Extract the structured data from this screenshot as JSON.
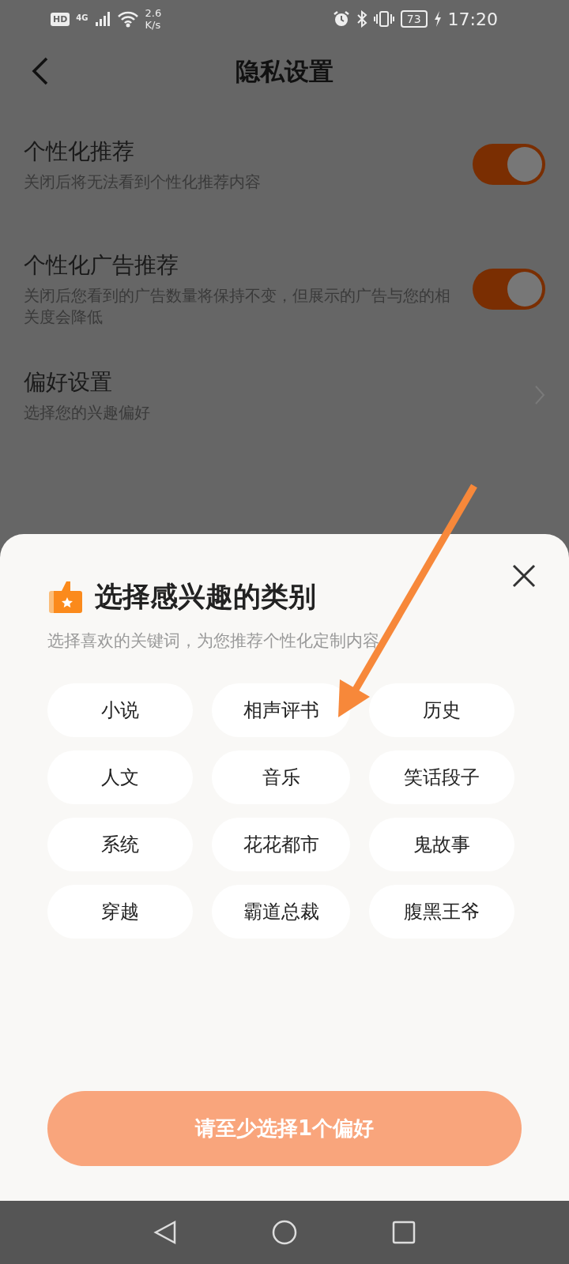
{
  "status_bar": {
    "hd": "HD",
    "network": "4G",
    "speed": "2.6",
    "speed_unit": "K/s",
    "battery": "73",
    "time": "17:20"
  },
  "header": {
    "title": "隐私设置"
  },
  "settings": [
    {
      "kind": "toggle",
      "title": "个性化推荐",
      "subtitle": "关闭后将无法看到个性化推荐内容",
      "on": true
    },
    {
      "kind": "toggle",
      "title": "个性化广告推荐",
      "subtitle": "关闭后您看到的广告数量将保持不变，但展示的广告与您的相关度会降低",
      "on": true
    },
    {
      "kind": "link",
      "title": "偏好设置",
      "subtitle": "选择您的兴趣偏好"
    }
  ],
  "sheet": {
    "title": "选择感兴趣的类别",
    "subtitle": "选择喜欢的关键词，为您推荐个性化定制内容",
    "categories": [
      {
        "label": "小说",
        "selected": false
      },
      {
        "label": "相声评书",
        "selected": false
      },
      {
        "label": "历史",
        "selected": false
      },
      {
        "label": "人文",
        "selected": false
      },
      {
        "label": "音乐",
        "selected": false
      },
      {
        "label": "笑话段子",
        "selected": false
      },
      {
        "label": "系统",
        "selected": false
      },
      {
        "label": "花花都市",
        "selected": false
      },
      {
        "label": "鬼故事",
        "selected": false
      },
      {
        "label": "穿越",
        "selected": false
      },
      {
        "label": "霸道总裁",
        "selected": false
      },
      {
        "label": "腹黑王爷",
        "selected": false
      }
    ],
    "confirm_button": {
      "label": "请至少选择1个偏好",
      "disabled": true
    }
  }
}
